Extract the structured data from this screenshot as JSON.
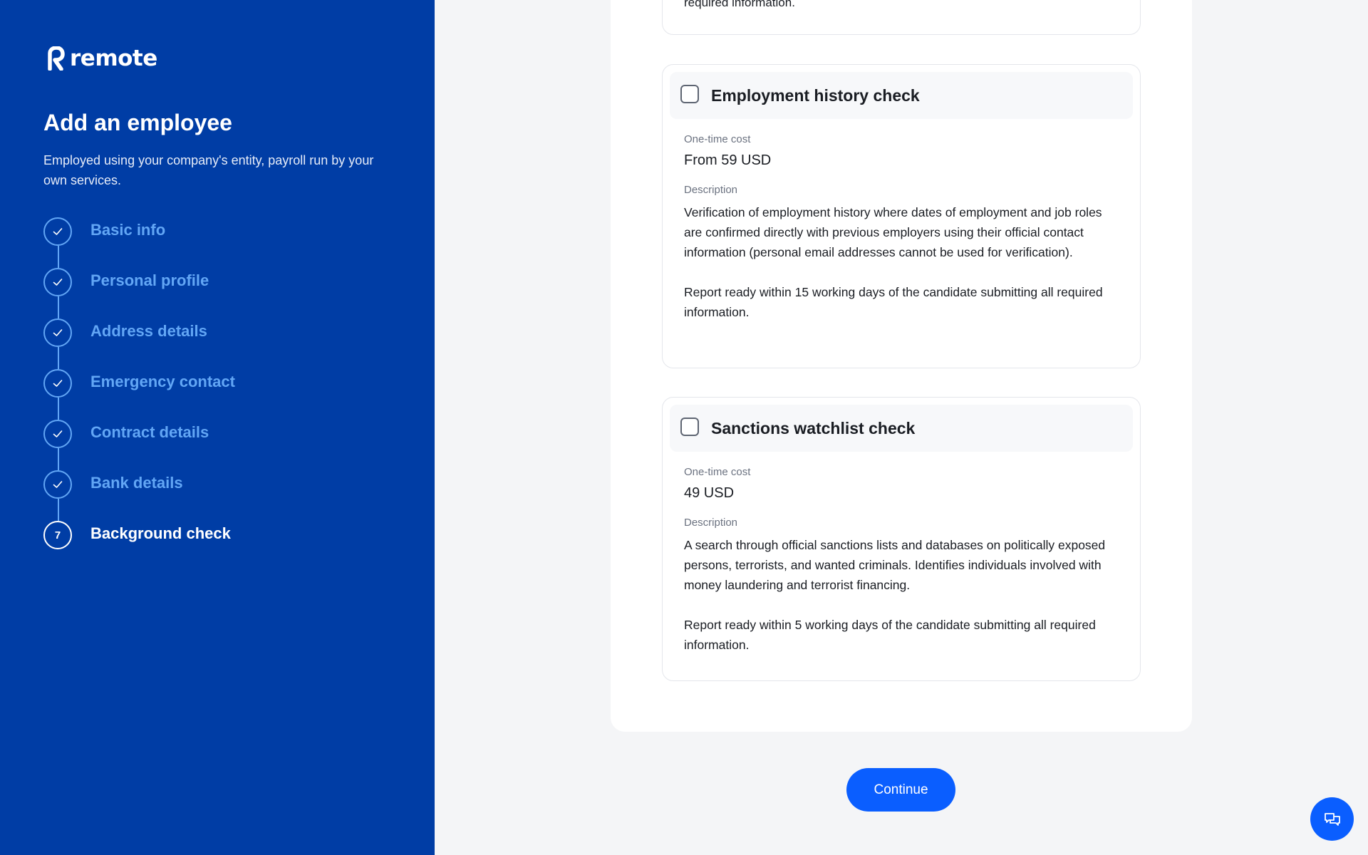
{
  "sidebar": {
    "logo_text": "remote",
    "title": "Add an employee",
    "subtitle": "Employed using your company's entity, payroll run by your own services.",
    "steps": [
      {
        "label": "Basic info",
        "status": "done",
        "icon": "check-icon"
      },
      {
        "label": "Personal profile",
        "status": "done",
        "icon": "check-icon"
      },
      {
        "label": "Address details",
        "status": "done",
        "icon": "check-icon"
      },
      {
        "label": "Emergency contact",
        "status": "done",
        "icon": "check-icon"
      },
      {
        "label": "Contract details",
        "status": "done",
        "icon": "check-icon"
      },
      {
        "label": "Bank details",
        "status": "done",
        "icon": "check-icon"
      },
      {
        "label": "Background check",
        "status": "current",
        "number": "7"
      }
    ]
  },
  "main": {
    "previous_card_tail": "required information.",
    "checks": [
      {
        "title": "Employment history check",
        "checked": false,
        "cost_label": "One-time cost",
        "cost": "From 59 USD",
        "description_label": "Description",
        "description": [
          "Verification of employment history where dates of employment and job roles are confirmed directly with previous employers using their official contact information (personal email addresses cannot be used for verification).",
          "Report ready within 15 working days of the candidate submitting all required information."
        ]
      },
      {
        "title": "Sanctions watchlist check",
        "checked": false,
        "cost_label": "One-time cost",
        "cost": "49 USD",
        "description_label": "Description",
        "description": [
          "A search through official sanctions lists and databases on politically exposed persons, terrorists, and wanted criminals. Identifies individuals involved with money laundering and terrorist financing.",
          "Report ready within 5 working days of the candidate submitting all required information."
        ]
      }
    ],
    "continue_label": "Continue"
  },
  "chat": {
    "icon": "chat-icon"
  },
  "colors": {
    "sidebar_bg": "#003da5",
    "step_done": "#62a6f5",
    "primary_button": "#0a5eff",
    "page_bg": "#f4f5f7"
  }
}
